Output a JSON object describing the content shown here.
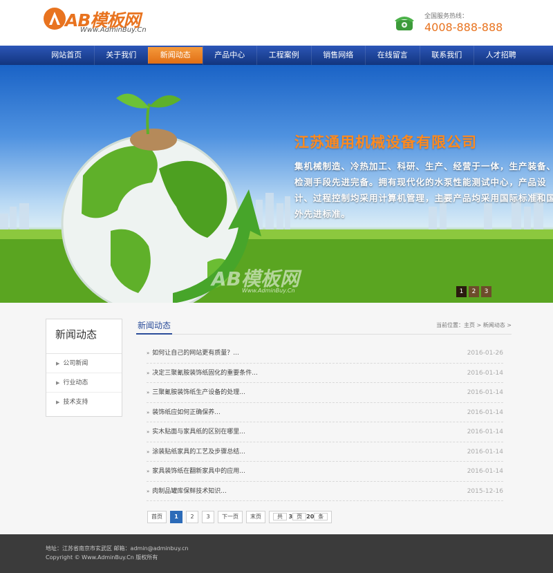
{
  "header": {
    "logo_text": "AB模板网",
    "logo_url": "Www.AdminBuy.Cn",
    "hotline_label": "全国服务热线：",
    "hotline_number": "4008-888-888"
  },
  "nav": {
    "items": [
      "网站首页",
      "关于我们",
      "新闻动态",
      "产品中心",
      "工程案例",
      "销售网络",
      "在线留言",
      "联系我们",
      "人才招聘"
    ],
    "active_index": 2
  },
  "banner": {
    "title": "江苏通用机械设备有限公司",
    "text": "集机械制造、冷热加工、科研、生产、经营于一体，生产装备、检测手段先进完备。拥有现代化的水泵性能测试中心，产品设计、过程控制均采用计算机管理，主要产品均采用国际标准和国外先进标准。",
    "watermark": "AB模板网",
    "watermark_url": "Www.AdminBuy.Cn",
    "slides": [
      "1",
      "2",
      "3"
    ],
    "active_slide": 0
  },
  "sidebar": {
    "title": "新闻动态",
    "items": [
      "公司新闻",
      "行业动态",
      "技术支持"
    ]
  },
  "main": {
    "title": "新闻动态",
    "breadcrumb": "当前位置：主页 > 新闻动态 >",
    "news": [
      {
        "title": "如何让自己的网站更有质量？...",
        "date": "2016-01-26"
      },
      {
        "title": "决定三聚氰胺装饰纸固化的重要条件...",
        "date": "2016-01-14"
      },
      {
        "title": "三聚氰胺装饰纸生产设备的处理...",
        "date": "2016-01-14"
      },
      {
        "title": "装饰纸应如何正确保养...",
        "date": "2016-01-14"
      },
      {
        "title": "实木贴面与家具纸的区别在哪里...",
        "date": "2016-01-14"
      },
      {
        "title": "涂装贴纸家具的工艺及步骤总结...",
        "date": "2016-01-14"
      },
      {
        "title": "家具装饰纸在翻新家具中的应用...",
        "date": "2016-01-14"
      },
      {
        "title": "肉制品罐库保鲜技术知识...",
        "date": "2015-12-16"
      }
    ]
  },
  "pager": {
    "first": "首页",
    "pages": [
      "1",
      "2",
      "3"
    ],
    "active_page": "1",
    "next": "下一页",
    "last": "末页",
    "summary_prefix": "共",
    "summary_pages": "3",
    "summary_mid": "页",
    "summary_count": "20",
    "summary_suffix": "条"
  },
  "footer": {
    "line1": "地址：江苏省南京市玄武区  邮箱：admin@adminbuy.cn",
    "line2": "Copyright © Www.AdminBuy.Cn 版权所有"
  },
  "colors": {
    "accent": "#e8731f",
    "nav_blue": "#1e47a0",
    "active_page": "#2c6bb8",
    "footer_bg": "#3b3b3b"
  }
}
